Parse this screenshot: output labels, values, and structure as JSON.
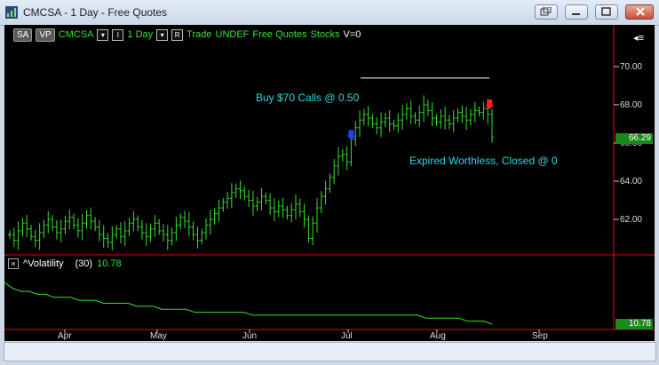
{
  "window": {
    "title": "CMCSA - 1 Day - Free Quotes",
    "buttons": [
      "restore-icon",
      "minimize-icon",
      "maximize-icon",
      "close-icon"
    ]
  },
  "toolbar": {
    "sa": "SA",
    "vp": "VP",
    "symbol": "CMCSA",
    "period_btn": "I",
    "interval": "1 Day",
    "r_btn": "R",
    "mode": "Trade",
    "account": "UNDEF",
    "feed": "Free Quotes",
    "type": "Stocks",
    "v": "V=0"
  },
  "colors": {
    "bars": "#35e035",
    "annotation": "#2ad8e6",
    "axis_red": "#d01010",
    "price_marker": "#1b8a1b",
    "buy_arrow": "#2040ff",
    "sell_arrow": "#ff2020"
  },
  "price_axis": {
    "labels": [
      "70.00",
      "68.00",
      "66.00",
      "64.00",
      "62.00"
    ],
    "last_price": "66.29"
  },
  "annotations": {
    "buy": "Buy $70 Calls @ 0.50",
    "expired": "Expired Worthless, Closed @ 0"
  },
  "indicator": {
    "name": "^Volatility",
    "period": "(30)",
    "value": "10.78",
    "last": "10.78"
  },
  "time_axis": {
    "labels": [
      "Apr",
      "May",
      "Jun",
      "Jul",
      "Aug",
      "Sep"
    ]
  },
  "chart_data": {
    "type": "ohlc",
    "series": [
      {
        "name": "CMCSA",
        "values": [
          61.2,
          60.9,
          61.4,
          61.8,
          61.5,
          61.1,
          60.9,
          61.3,
          61.7,
          62.0,
          61.6,
          61.3,
          61.5,
          61.9,
          62.1,
          61.7,
          61.4,
          61.8,
          62.2,
          61.9,
          61.6,
          61.2,
          61.0,
          60.8,
          61.2,
          61.5,
          61.1,
          61.4,
          61.8,
          62.0,
          61.6,
          61.3,
          61.1,
          61.5,
          61.8,
          61.4,
          61.2,
          60.9,
          61.3,
          61.7,
          62.1,
          61.9,
          61.6,
          61.2,
          60.9,
          61.3,
          61.7,
          62.0,
          62.3,
          62.6,
          62.9,
          63.1,
          63.4,
          63.6,
          63.5,
          63.2,
          63.0,
          62.7,
          62.9,
          63.2,
          63.0,
          62.6,
          62.4,
          62.7,
          62.5,
          62.2,
          62.5,
          62.8,
          62.4,
          62.0,
          61.0,
          61.8,
          62.6,
          63.2,
          63.6,
          64.2,
          64.8,
          65.3,
          65.4,
          65.0,
          66.2,
          66.8,
          67.2,
          67.5,
          67.3,
          67.0,
          66.8,
          67.1,
          67.3,
          67.0,
          66.9,
          67.2,
          67.5,
          67.8,
          67.4,
          67.2,
          67.6,
          68.0,
          67.7,
          67.3,
          67.1,
          67.4,
          67.2,
          67.0,
          67.3,
          67.6,
          67.4,
          67.2,
          67.5,
          67.7,
          67.6,
          67.8,
          67.5,
          66.3
        ],
        "ylim": [
          60,
          71
        ]
      },
      {
        "name": "^Volatility",
        "values": [
          24,
          22,
          21,
          21,
          20,
          20,
          19,
          19,
          19,
          18,
          18,
          18,
          17,
          17,
          17,
          17,
          16,
          16,
          16,
          15,
          15,
          15,
          15,
          14,
          14,
          14,
          14,
          14,
          14,
          14,
          13,
          13,
          13,
          13,
          13,
          13,
          13,
          13,
          13,
          13,
          13,
          13,
          13,
          13,
          13,
          13,
          13,
          13,
          13,
          13,
          13,
          12,
          12,
          12,
          12,
          12,
          11,
          11,
          11,
          10
        ]
      }
    ]
  }
}
